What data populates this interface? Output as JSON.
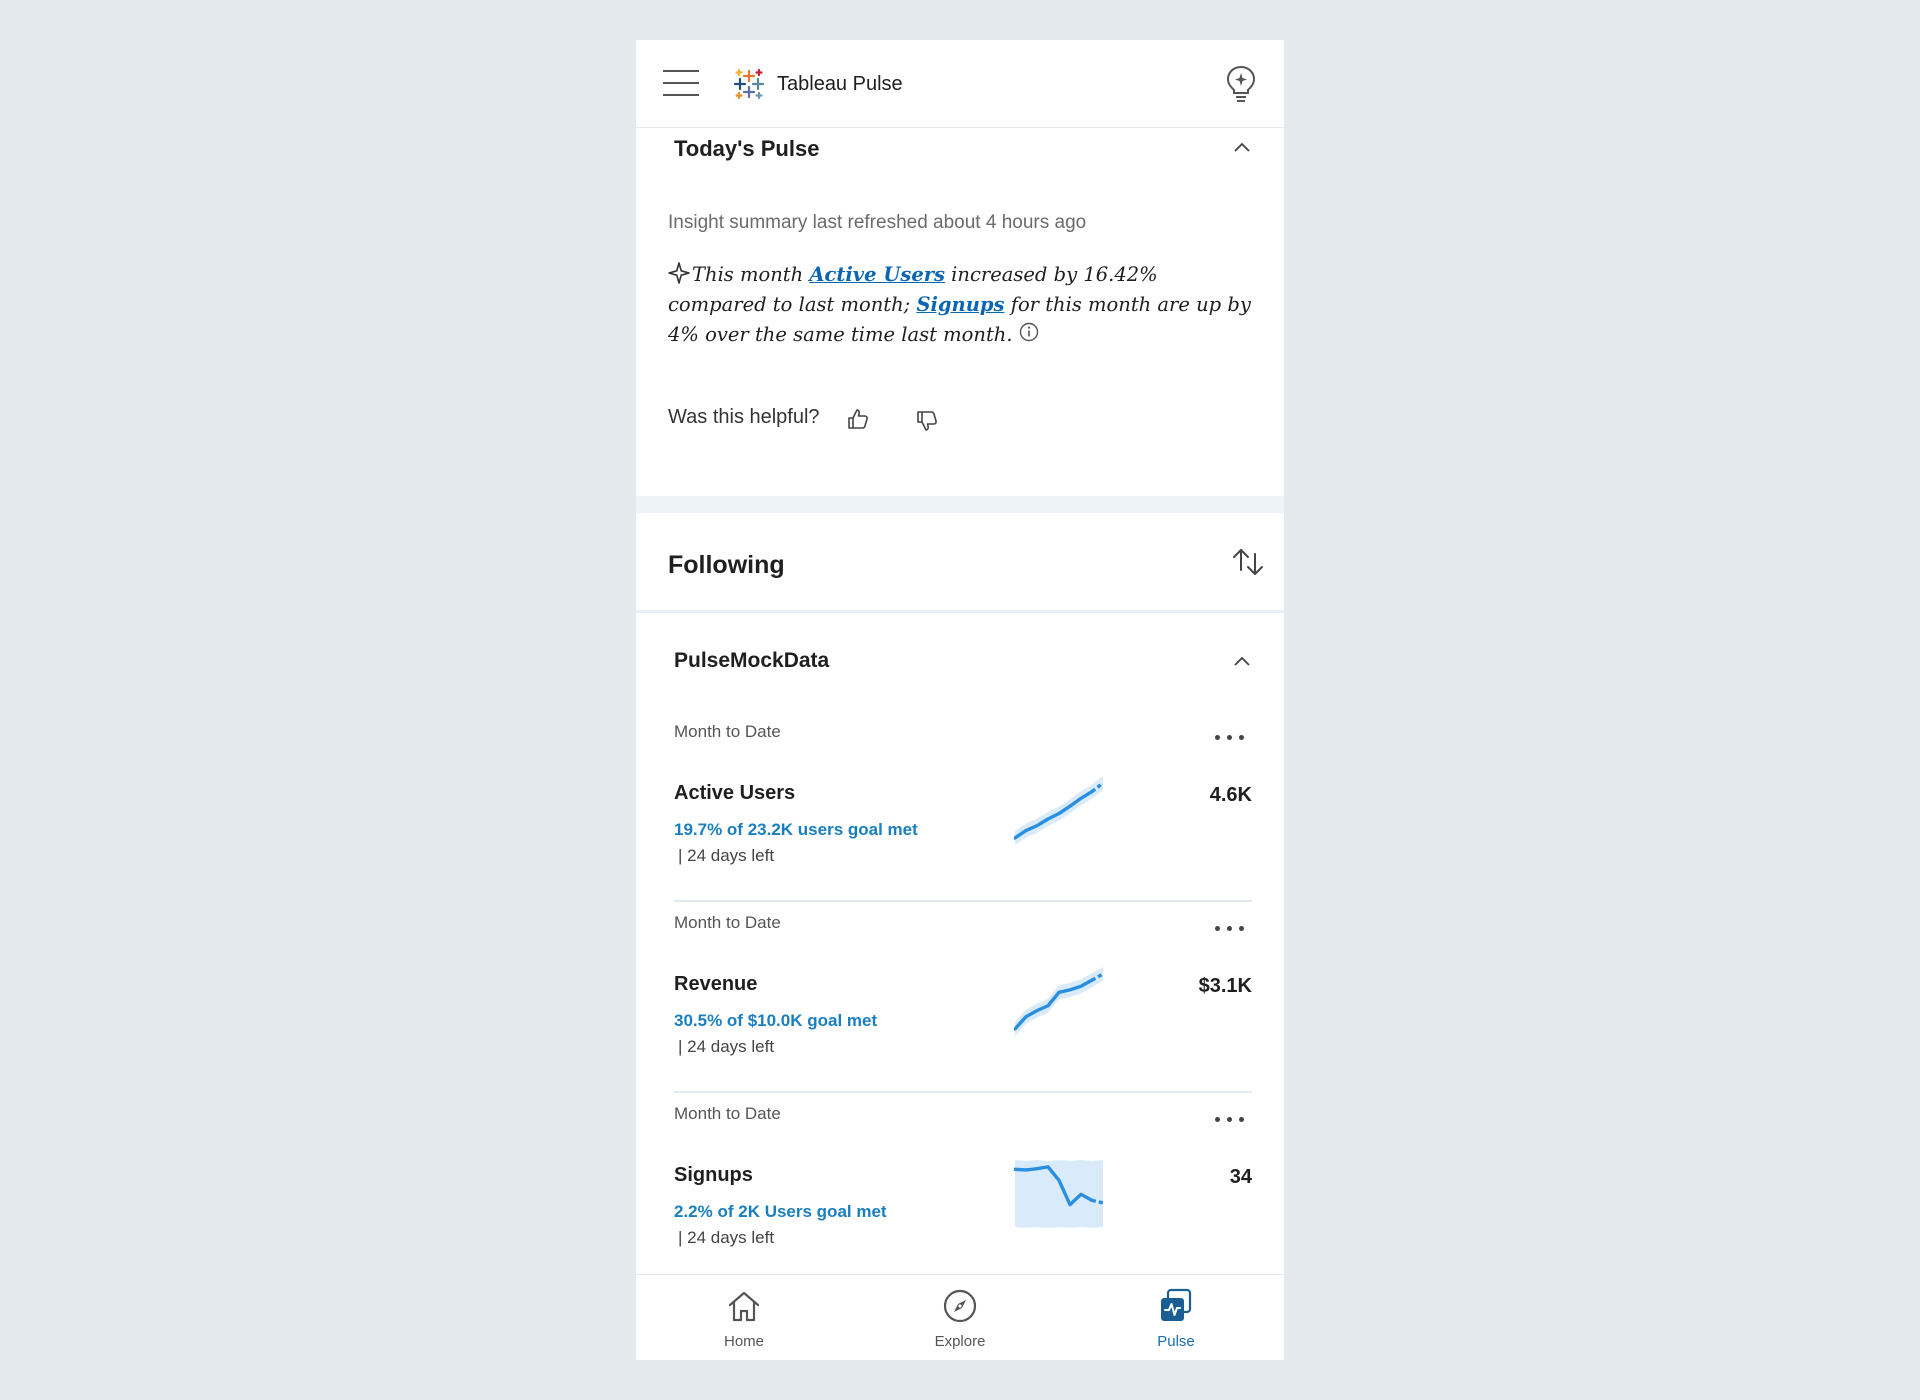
{
  "header": {
    "app_title": "Tableau Pulse",
    "menu_icon": "hamburger-menu-icon",
    "insight_icon": "lightbulb-sparkle-icon"
  },
  "todays_pulse": {
    "title": "Today's Pulse",
    "refreshed_text": "Insight summary last refreshed about 4 hours ago",
    "summary": {
      "part1": "This month ",
      "link1": "Active Users",
      "part2": " increased by 16.42% compared to last month; ",
      "link2": "Signups",
      "part3": " for this month are up by 4% over the same time last month."
    },
    "helpful_label": "Was this helpful?"
  },
  "following": {
    "title": "Following",
    "group_title": "PulseMockData",
    "metrics": [
      {
        "period": "Month to Date",
        "name": "Active Users",
        "goal_text": "19.7% of 23.2K users goal met",
        "days_left": "| 24 days left",
        "value": "4.6K",
        "trend": [
          1,
          2.2,
          3,
          4.1,
          5,
          6.2,
          7.5,
          8.6,
          10
        ]
      },
      {
        "period": "Month to Date",
        "name": "Revenue",
        "goal_text": "30.5% of $10.0K goal met",
        "days_left": "| 24 days left",
        "value": "$3.1K",
        "trend": [
          1,
          3,
          4,
          4.8,
          7,
          7.4,
          8,
          9,
          10
        ]
      },
      {
        "period": "Month to Date",
        "name": "Signups",
        "goal_text": "2.2% of 2K Users goal met",
        "days_left": "| 24 days left",
        "value": "34",
        "trend": [
          9.3,
          9.2,
          9.4,
          9.7,
          7.5,
          3.5,
          5.2,
          4.2,
          3.8
        ]
      }
    ]
  },
  "bottom_nav": {
    "items": [
      {
        "label": "Home",
        "icon": "home-icon"
      },
      {
        "label": "Explore",
        "icon": "compass-icon"
      },
      {
        "label": "Pulse",
        "icon": "pulse-icon"
      }
    ]
  },
  "colors": {
    "accent": "#1a7fc1",
    "link": "#0a66b2",
    "line": "#2a8fe0",
    "band": "#d9ebfa"
  }
}
